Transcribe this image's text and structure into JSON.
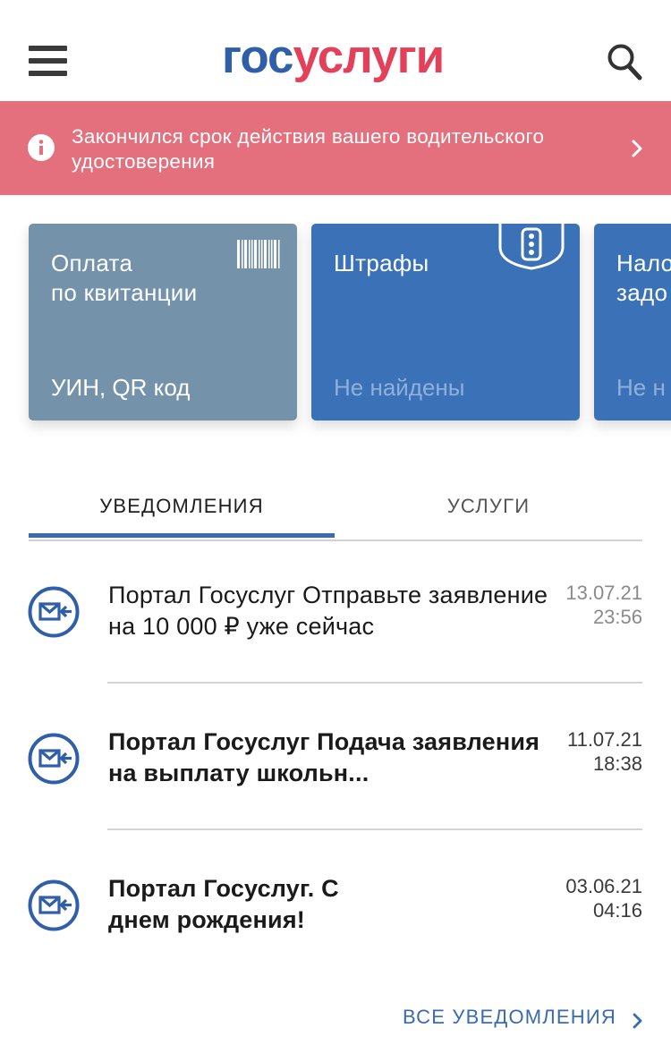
{
  "header": {
    "logo_part1": "гос",
    "logo_part2": "услуги"
  },
  "alert": {
    "text": "Закончился срок действия вашего водительского удостоверения"
  },
  "cards": [
    {
      "title": "Оплата\nпо квитанции",
      "subtitle": "УИН, QR код"
    },
    {
      "title": "Штрафы",
      "subtitle": "Не найдены"
    },
    {
      "title": "Нало\nзадо",
      "subtitle": "Не н"
    }
  ],
  "tabs": {
    "notifications": "УВЕДОМЛЕНИЯ",
    "services": "УСЛУГИ"
  },
  "notifications": [
    {
      "text": "Портал Госуслуг Отправьте заявление на 10 000 ₽ уже сейчас",
      "date": "13.07.21",
      "time": "23:56"
    },
    {
      "text": "Портал Госуслуг Подача заявления на выплату школьн...",
      "date": "11.07.21",
      "time": "18:38"
    },
    {
      "text": "Портал Госуслуг. С днем рождения!",
      "date": "03.06.21",
      "time": "04:16"
    }
  ],
  "footer": {
    "all_notifications": "ВСЕ УВЕДОМЛЕНИЯ"
  },
  "colors": {
    "brand_blue": "#2f5fa8",
    "brand_red": "#e4405a",
    "alert_bg": "#e3707c",
    "card_gray": "#7493ab",
    "card_blue": "#3b72b7",
    "link_blue": "#3a6bb0"
  }
}
